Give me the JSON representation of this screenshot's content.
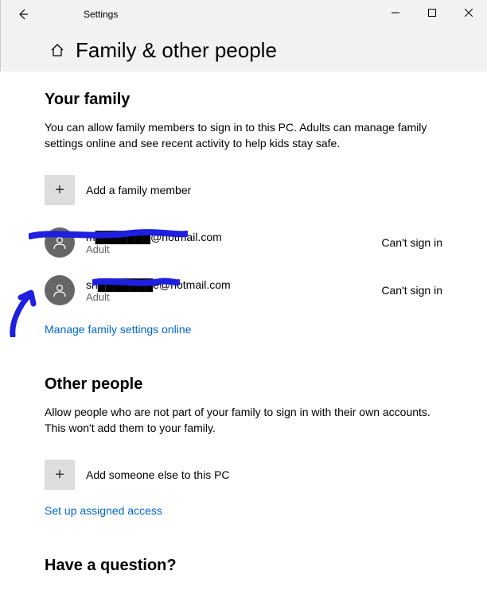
{
  "titlebar": {
    "app_name": "Settings",
    "page_title": "Family & other people"
  },
  "family": {
    "section_title": "Your family",
    "description": "You can allow family members to sign in to this PC. Adults can manage family settings online and see recent activity to help kids stay safe.",
    "add_label": "Add a family member",
    "members": [
      {
        "email": "m███████@hotmail.com",
        "role": "Adult",
        "status": "Can't sign in"
      },
      {
        "email": "sh███████e@hotmail.com",
        "role": "Adult",
        "status": "Can't sign in"
      }
    ],
    "manage_link": "Manage family settings online"
  },
  "other": {
    "section_title": "Other people",
    "description": "Allow people who are not part of your family to sign in with their own accounts. This won't add them to your family.",
    "add_label": "Add someone else to this PC",
    "assigned_link": "Set up assigned access"
  },
  "question": {
    "section_title": "Have a question?"
  },
  "annotation_color": "#1f1fe0"
}
